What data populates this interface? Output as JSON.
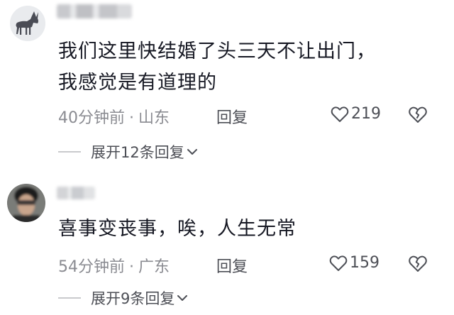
{
  "comments": [
    {
      "content_lines": [
        "我们这里快结婚了头三天不让出门，",
        "我感觉是有道理的"
      ],
      "time": "40分钟前",
      "location": "山东",
      "reply_label": "回复",
      "likes": "219",
      "expand_label": "展开12条回复"
    },
    {
      "content_lines": [
        "喜事变丧事，唉，人生无常"
      ],
      "time": "54分钟前",
      "location": "广东",
      "reply_label": "回复",
      "likes": "159",
      "expand_label": "展开9条回复"
    }
  ],
  "separator": "·",
  "icons": [
    "donkey-avatar-icon",
    "heart-icon",
    "broken-heart-icon",
    "chevron-down-icon"
  ],
  "colors": {
    "text": "#161823",
    "meta": "#8a8b91",
    "secondary": "#4d4f56"
  }
}
